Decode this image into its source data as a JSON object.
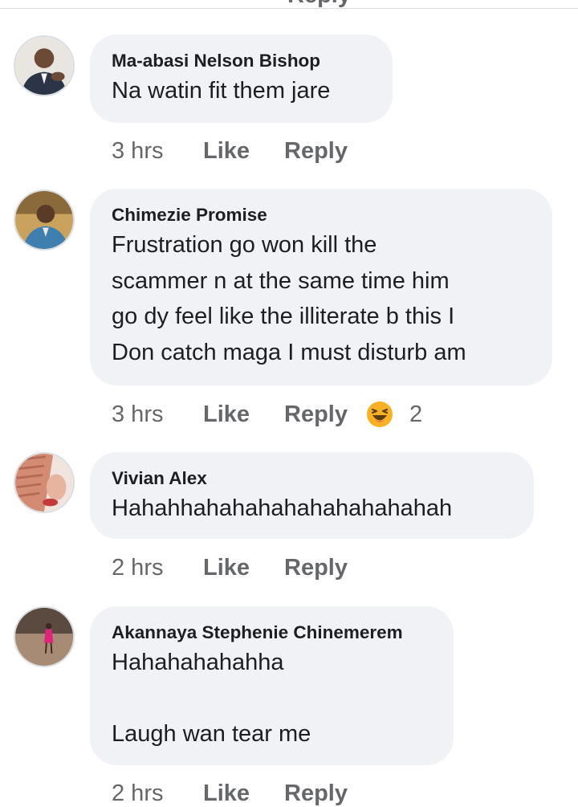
{
  "top_cut_label": "Reply",
  "comments": [
    {
      "author": "Ma-abasi Nelson Bishop",
      "text": "Na watin fit them jare",
      "time": "3 hrs",
      "like_label": "Like",
      "reply_label": "Reply"
    },
    {
      "author": "Chimezie Promise",
      "text": "Frustration go won kill the\nscammer n at the same time him\ngo dy feel like the illiterate b this I\nDon catch maga I must disturb am",
      "time": "3 hrs",
      "like_label": "Like",
      "reply_label": "Reply",
      "reaction": {
        "icon": "laughing-emoji-icon",
        "count": "2"
      }
    },
    {
      "author": "Vivian Alex",
      "text": "Hahahhahahahahahahahahahah",
      "time": "2 hrs",
      "like_label": "Like",
      "reply_label": "Reply"
    },
    {
      "author": "Akannaya Stephenie Chinemerem",
      "text": "Hahahahahahha\n\nLaugh wan tear me",
      "time": "2 hrs",
      "like_label": "Like",
      "reply_label": "Reply"
    }
  ],
  "colors": {
    "bubble": "#f0f2f5",
    "secondary_text": "#65676b",
    "primary_text": "#1c1e21",
    "reaction_yellow": "#f7b125"
  }
}
